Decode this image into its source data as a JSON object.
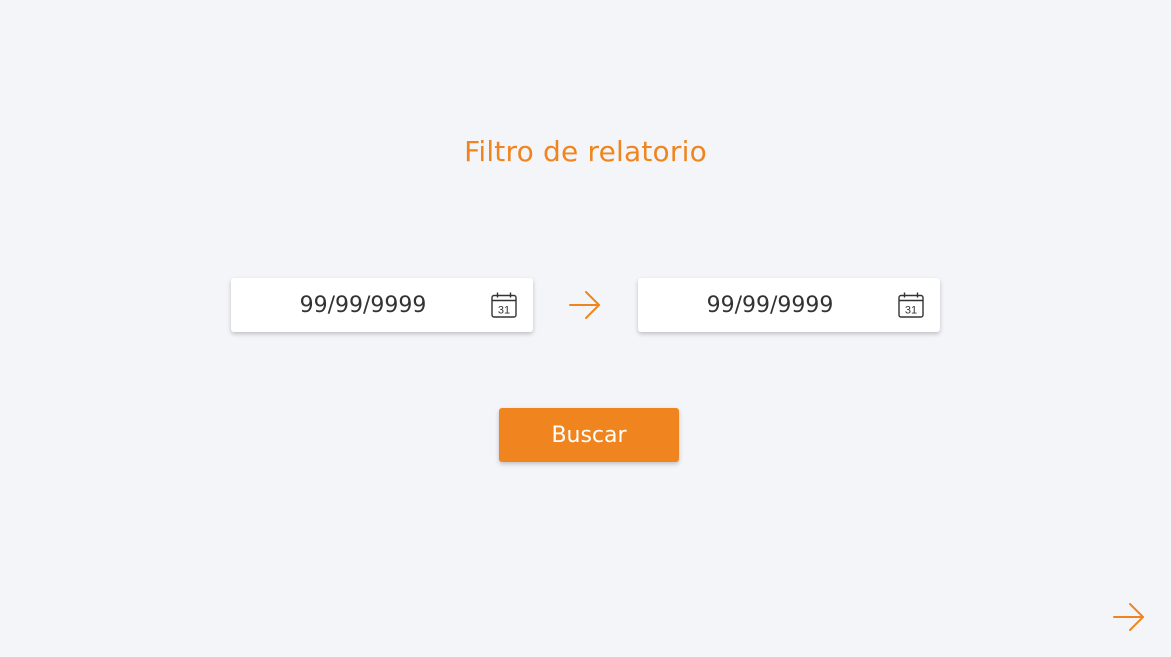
{
  "page": {
    "title": "Filtro de relatorio"
  },
  "filter": {
    "start_date": {
      "value": "99/99/9999",
      "icon": "calendar-icon",
      "icon_day": "31"
    },
    "range_icon": "arrow-right-icon",
    "end_date": {
      "value": "99/99/9999",
      "icon": "calendar-icon",
      "icon_day": "31"
    },
    "search_label": "Buscar"
  },
  "footer": {
    "next_icon": "arrow-right-icon"
  },
  "colors": {
    "accent": "#f0851f",
    "background": "#f4f5f9",
    "field_background": "#ffffff",
    "text": "#333333",
    "button_text": "#ffffff"
  }
}
